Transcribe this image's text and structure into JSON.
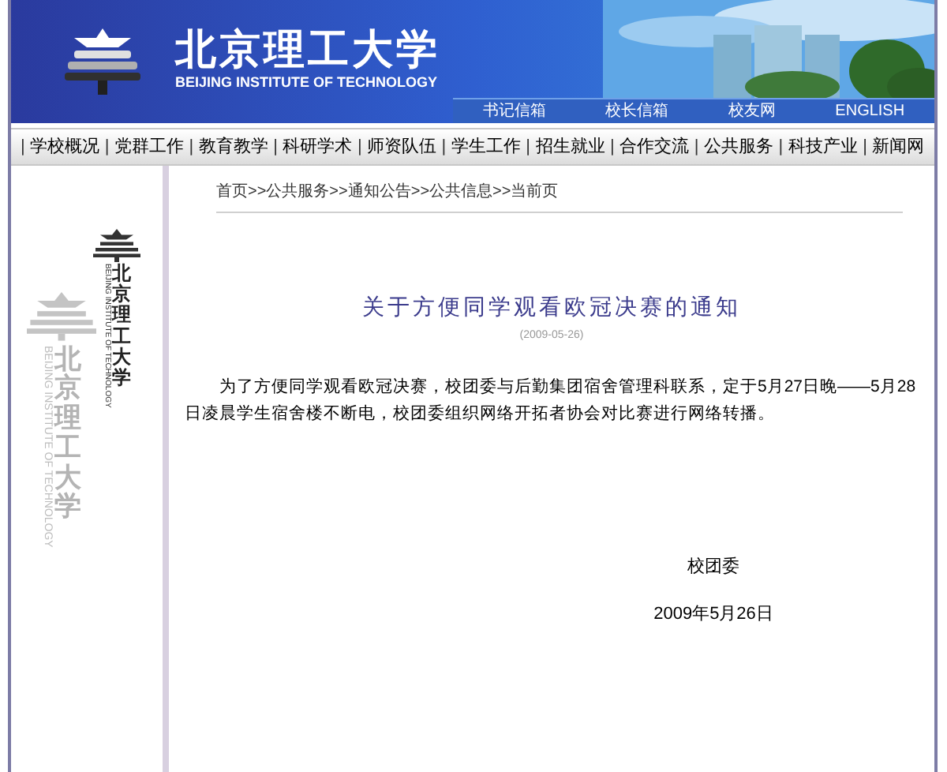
{
  "header": {
    "title": "北京理工大学",
    "subtitle": "BEIJING INSTITUTE OF TECHNOLOGY",
    "links": [
      "书记信箱",
      "校长信箱",
      "校友网",
      "ENGLISH"
    ]
  },
  "nav": {
    "separator": "|",
    "items": [
      "学校概况",
      "党群工作",
      "教育教学",
      "科研学术",
      "师资队伍",
      "学生工作",
      "招生就业",
      "合作交流",
      "公共服务",
      "科技产业",
      "新闻网"
    ]
  },
  "sidebar": {
    "logos": [
      {
        "name": "北京理工大学",
        "subtitle": "BEIJING INSTITUTE OF TECHNOLOGY"
      },
      {
        "name": "北京理工大学",
        "subtitle": "BEIJING INSTITUTE OF TECHNOLOGY"
      }
    ]
  },
  "breadcrumb": {
    "separator": ">>",
    "items": [
      "首页",
      "公共服务",
      "通知公告",
      "公共信息",
      "当前页"
    ]
  },
  "article": {
    "title": "关于方便同学观看欧冠决赛的通知",
    "date": "(2009-05-26)",
    "body": "为了方便同学观看欧冠决赛，校团委与后勤集团宿舍管理科联系，定于5月27日晚——5月28日凌晨学生宿舍楼不断电，校团委组织网络开拓者协会对比赛进行网络转播。",
    "signature": "校团委",
    "signed_date": "2009年5月26日"
  }
}
